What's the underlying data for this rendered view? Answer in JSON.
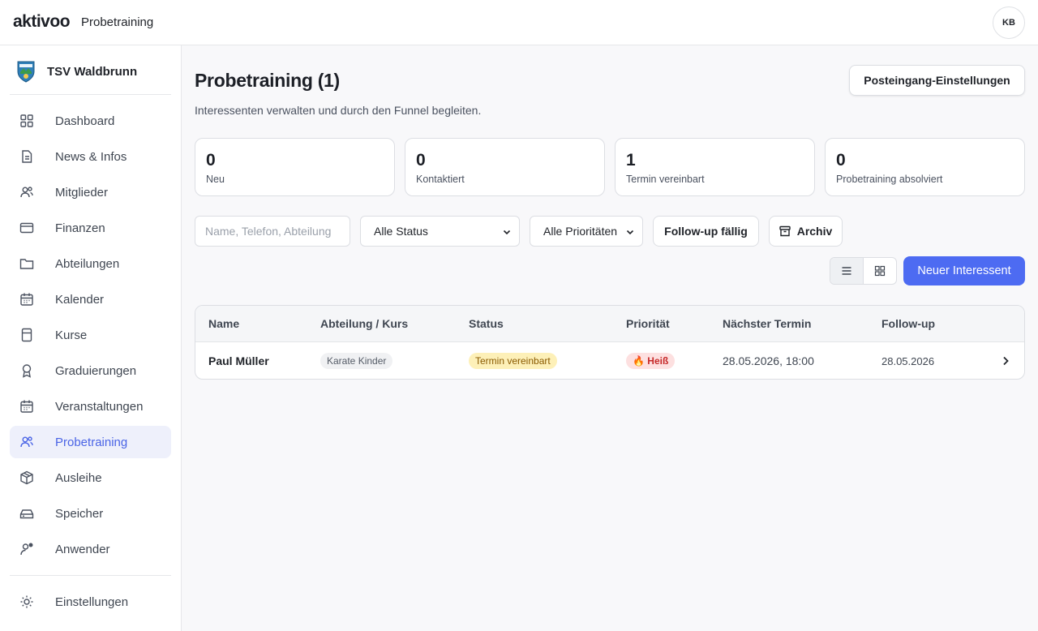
{
  "header": {
    "logo_text": "aktivoo",
    "app_title": "Probetraining",
    "user_initials": "KB"
  },
  "sidebar": {
    "club_name": "TSV Waldbrunn",
    "items": [
      {
        "label": "Dashboard",
        "icon": "grid-icon"
      },
      {
        "label": "News & Infos",
        "icon": "document-icon"
      },
      {
        "label": "Mitglieder",
        "icon": "users-icon"
      },
      {
        "label": "Finanzen",
        "icon": "wallet-icon"
      },
      {
        "label": "Abteilungen",
        "icon": "folder-icon"
      },
      {
        "label": "Kalender",
        "icon": "calendar-icon"
      },
      {
        "label": "Kurse",
        "icon": "book-icon"
      },
      {
        "label": "Graduierungen",
        "icon": "award-icon"
      },
      {
        "label": "Veranstaltungen",
        "icon": "calendar-icon"
      },
      {
        "label": "Probetraining",
        "icon": "users-icon",
        "active": true
      },
      {
        "label": "Ausleihe",
        "icon": "package-icon"
      },
      {
        "label": "Speicher",
        "icon": "storage-icon"
      },
      {
        "label": "Anwender",
        "icon": "user-cog-icon"
      }
    ],
    "settings_label": "Einstellungen"
  },
  "main": {
    "title": "Probetraining (1)",
    "subtitle": "Interessenten verwalten und durch den Funnel begleiten.",
    "settings_button": "Posteingang-Einstellungen",
    "stats": [
      {
        "value": "0",
        "label": "Neu"
      },
      {
        "value": "0",
        "label": "Kontaktiert"
      },
      {
        "value": "1",
        "label": "Termin vereinbart"
      },
      {
        "value": "0",
        "label": "Probetraining absolviert"
      }
    ],
    "filters": {
      "search_placeholder": "Name, Telefon, Abteilung",
      "status_selected": "Alle Status",
      "priority_selected": "Alle Prioritäten",
      "followup_button": "Follow-up fällig",
      "archive_button": "Archiv"
    },
    "new_button": "Neuer Interessent",
    "table": {
      "columns": [
        "Name",
        "Abteilung / Kurs",
        "Status",
        "Priorität",
        "Nächster Termin",
        "Follow-up"
      ],
      "rows": [
        {
          "name": "Paul Müller",
          "course": "Karate Kinder",
          "status": "Termin vereinbart",
          "priority": "🔥 Heiß",
          "next_appointment": "28.05.2026, 18:00",
          "follow_up": "28.05.2026"
        }
      ]
    }
  },
  "colors": {
    "accent": "#4d6bf2",
    "active_bg": "#eef0fb",
    "status_bg": "#fdf0b8",
    "priority_bg": "#fde0e0"
  }
}
